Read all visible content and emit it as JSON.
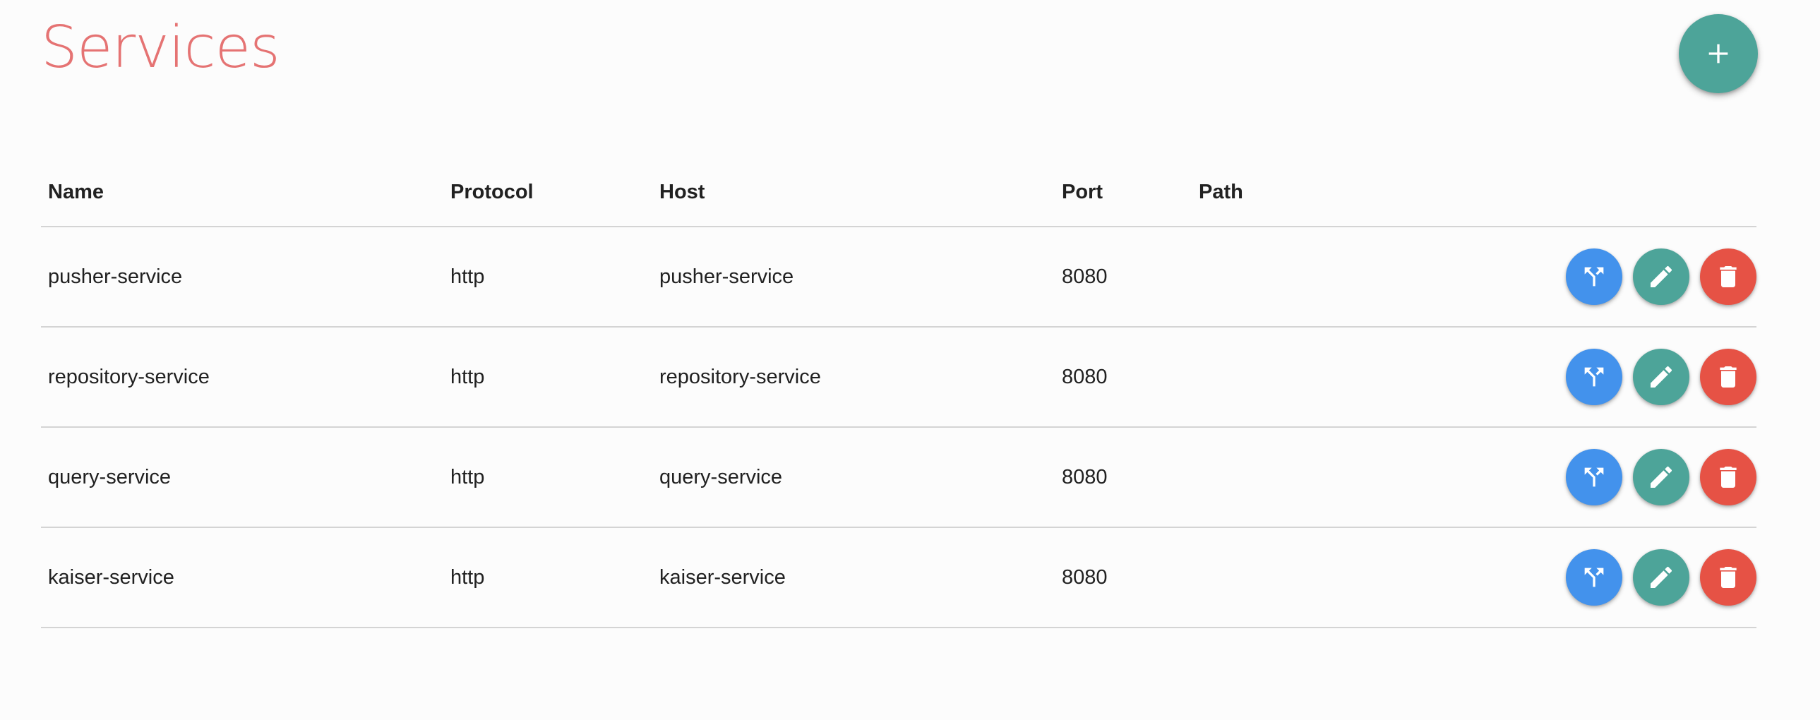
{
  "page": {
    "title": "Services"
  },
  "add_button": {
    "icon": "plus-icon",
    "color": "#4da499"
  },
  "table": {
    "columns": [
      "Name",
      "Protocol",
      "Host",
      "Port",
      "Path"
    ],
    "rows": [
      {
        "name": "pusher-service",
        "protocol": "http",
        "host": "pusher-service",
        "port": "8080",
        "path": ""
      },
      {
        "name": "repository-service",
        "protocol": "http",
        "host": "repository-service",
        "port": "8080",
        "path": ""
      },
      {
        "name": "query-service",
        "protocol": "http",
        "host": "query-service",
        "port": "8080",
        "path": ""
      },
      {
        "name": "kaiser-service",
        "protocol": "http",
        "host": "kaiser-service",
        "port": "8080",
        "path": ""
      }
    ]
  },
  "row_actions": [
    {
      "icon": "call-split-icon",
      "color": "#4392ec"
    },
    {
      "icon": "pencil-icon",
      "color": "#4da499"
    },
    {
      "icon": "trash-icon",
      "color": "#e65245"
    }
  ],
  "colors": {
    "title": "#e57373",
    "background": "#fcfcfc",
    "divider": "#d4d4d4"
  }
}
